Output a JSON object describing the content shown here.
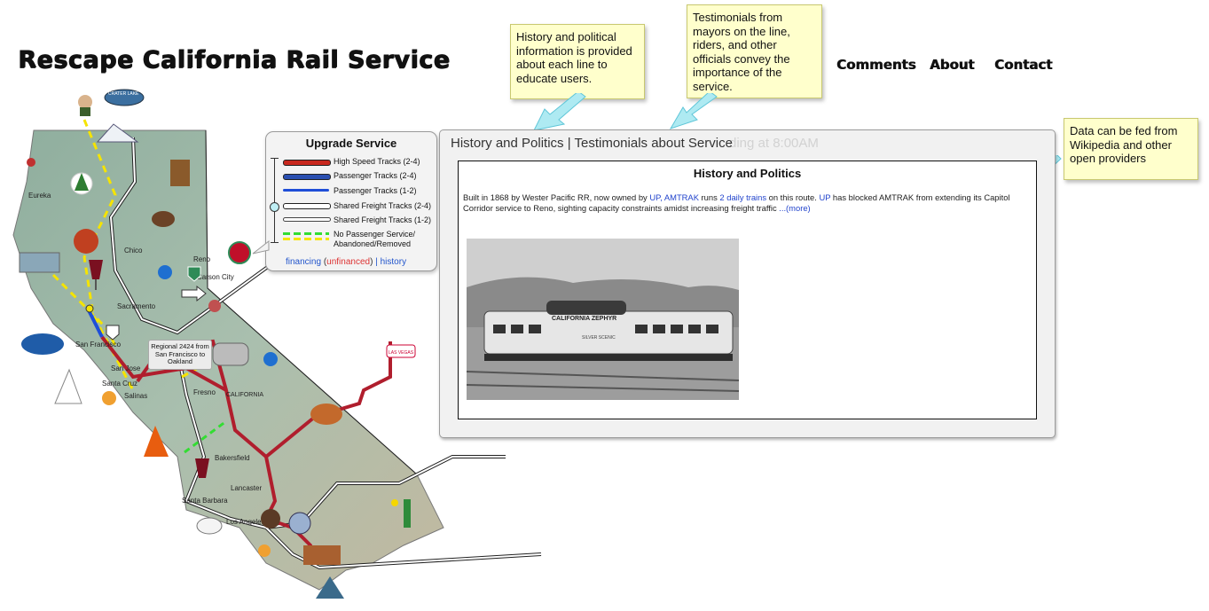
{
  "site": {
    "title": "Rescape California Rail Service"
  },
  "nav": {
    "comments": "Comments",
    "about": "About",
    "contact": "Contact"
  },
  "notes": {
    "history": "History and political information is provided about each line to educate users.",
    "testimonials": "Testimonials from mayors on the line, riders, and other officials convey the importance of the service.",
    "data": "Data can be fed from Wikipedia and other open providers"
  },
  "legend": {
    "title": "Upgrade Service",
    "items": [
      {
        "label": "High Speed Tracks (2-4)",
        "color": "#c8281e"
      },
      {
        "label": "Passenger Tracks (2-4)",
        "color": "#2a4fb0"
      },
      {
        "label": "Passenger Tracks (1-2)",
        "color": "#1f4ed8"
      },
      {
        "label": "Shared Freight Tracks (2-4)",
        "color": "#ffffff"
      },
      {
        "label": "Shared Freight Tracks (1-2)",
        "color": "#ffffff"
      },
      {
        "label": "No Passenger Service/ Abandoned/Removed",
        "color": "#33dd33"
      }
    ],
    "links": {
      "financing": "financing",
      "unfinanced": "unfinanced",
      "history": "history",
      "separator": "|"
    }
  },
  "map": {
    "labels": [
      "Eureka",
      "Chico",
      "Reno",
      "Carson City",
      "Sacramento",
      "San Francisco",
      "San Jose",
      "Santa Cruz",
      "Salinas",
      "Fresno",
      "CALIFORNIA",
      "Bakersfield",
      "Lancaster",
      "Santa Barbara",
      "Los Angeles",
      "CRATER LAKE",
      "LAS VEGAS"
    ],
    "tooltip": "Regional 2424 from San Francisco to Oakland"
  },
  "panel": {
    "tabs": "History and Politics | Testimonials about Service",
    "ghost_text": "ding at 8:00AM",
    "section_title": "History and Politics",
    "body": {
      "t1": "Built in 1868 by Wester Pacific RR, now owned by ",
      "l1": "UP",
      "t2": ", ",
      "l2": "AMTRAK",
      "t3": " runs ",
      "l3": "2 daily trains",
      "t4": " on this route. ",
      "l4": "UP",
      "t5": " has blocked AMTRAK from extending its Capitol Corridor service to Reno, sighting capacity constraints amidst increasing freight traffic ",
      "l5": "...(more)"
    },
    "photo_caption": "CALIFORNIA ZEPHYR",
    "photo_subcaption": "SILVER SCENIC"
  },
  "colors": {
    "high_speed": "#b01e2d",
    "freight": "#ffffff",
    "abandoned": "#f5e400",
    "green_dash": "#33dd33"
  }
}
